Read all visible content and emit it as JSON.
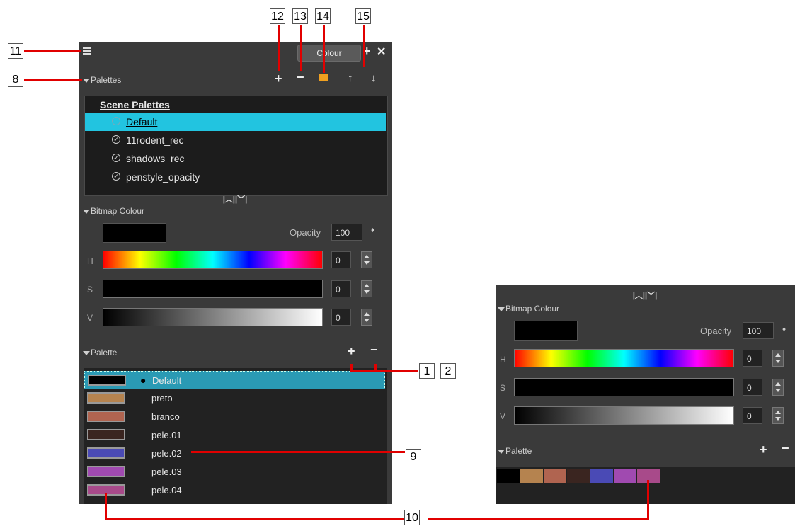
{
  "window": {
    "tab_label": "Colour"
  },
  "callouts": {
    "c1": "1",
    "c2": "2",
    "c8": "8",
    "c9": "9",
    "c10": "10",
    "c11": "11",
    "c12": "12",
    "c13": "13",
    "c14": "14",
    "c15": "15"
  },
  "palettes_section": {
    "title": "Palettes",
    "list_header": "Scene Palettes",
    "items": [
      {
        "name": "Default",
        "selected": true
      },
      {
        "name": "11rodent_rec"
      },
      {
        "name": "shadows_rec"
      },
      {
        "name": "penstyle_opacity"
      }
    ]
  },
  "bitmap_colour": {
    "title": "Bitmap Colour",
    "opacity_label": "Opacity",
    "opacity_value": "100",
    "channels": [
      {
        "label": "H",
        "value": "0"
      },
      {
        "label": "S",
        "value": "0"
      },
      {
        "label": "V",
        "value": "0"
      }
    ],
    "current_color": "#000000"
  },
  "palette_section": {
    "title": "Palette",
    "swatches": [
      {
        "name": "Default",
        "color": "#000000",
        "selected": true
      },
      {
        "name": "preto",
        "color": "#b5834f"
      },
      {
        "name": "branco",
        "color": "#b06450"
      },
      {
        "name": "pele.01",
        "color": "#3a2520"
      },
      {
        "name": "pele.02",
        "color": "#4a4ab5"
      },
      {
        "name": "pele.03",
        "color": "#a04ab0"
      },
      {
        "name": "pele.04",
        "color": "#a84a8a"
      }
    ]
  },
  "icons": {
    "menu": "hamburger-menu-icon",
    "add": "plus-icon",
    "remove": "minus-icon",
    "folder": "folder-icon",
    "up": "arrow-up-icon",
    "down": "arrow-down-icon",
    "close": "close-icon"
  }
}
